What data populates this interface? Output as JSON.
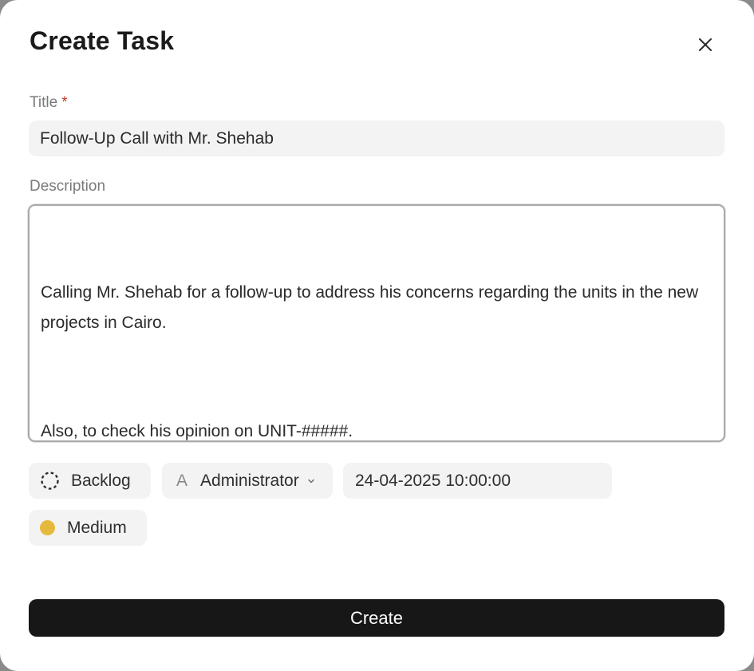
{
  "dialog": {
    "title": "Create Task",
    "close_icon": "close-icon"
  },
  "fields": {
    "title_label": "Title",
    "title_required_mark": "*",
    "title_value": "Follow-Up Call with Mr. Shehab",
    "description_label": "Description",
    "description_paragraphs": [
      "Calling Mr. Shehab for a follow-up to address his concerns regarding the units in the new projects in Cairo.",
      "Also, to check his opinion on UNIT-#####."
    ]
  },
  "chips": {
    "status": {
      "label": "Backlog",
      "icon": "dashed-circle-icon"
    },
    "assignee": {
      "avatar_letter": "A",
      "label": "Administrator",
      "icon": "chevron-down-icon"
    },
    "due_date": {
      "value": "24-04-2025 10:00:00"
    },
    "priority": {
      "label": "Medium",
      "icon": "priority-dot-icon",
      "color": "#E6B93C"
    }
  },
  "actions": {
    "create_label": "Create"
  },
  "colors": {
    "primary_button": "#171717",
    "required": "#C0392B",
    "chip_background": "#F3F3F3"
  }
}
